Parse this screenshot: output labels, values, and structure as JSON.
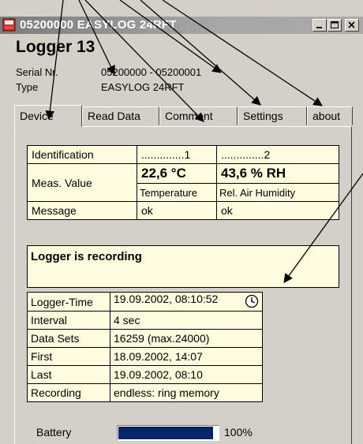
{
  "window": {
    "title": "05200000 EASYLOG 24RFT",
    "icon": "logger-app-icon",
    "controls": [
      "minimize",
      "maximize",
      "close"
    ]
  },
  "header": {
    "title": "Logger 13",
    "serial_label": "Serial Nr.",
    "serial_value": "05200000 - 05200001",
    "type_label": "Type",
    "type_value": "EASYLOG 24RFT"
  },
  "tabs": [
    {
      "label": "Device",
      "active": true
    },
    {
      "label": "Read Data"
    },
    {
      "label": "Comment"
    },
    {
      "label": "Settings"
    },
    {
      "label": "about"
    }
  ],
  "measurements": {
    "identification_label": "Identification",
    "id_1": "..............1",
    "id_2": "..............2",
    "meas_label": "Meas. Value",
    "value_1": "22,6 °C",
    "value_2": "43,6 % RH",
    "unit_1": "Temperature",
    "unit_2": "Rel. Air Humidity",
    "message_label": "Message",
    "message_1": "ok",
    "message_2": "ok"
  },
  "status": "Logger is recording",
  "info": {
    "time_label": "Logger-Time",
    "time_value": "19.09.2002, 08:10:52",
    "interval_label": "Interval",
    "interval_value": "4 sec",
    "datasets_label": "Data Sets",
    "datasets_value": "16259 (max.24000)",
    "first_label": "First",
    "first_value": "18.09.2002, 14:07",
    "last_label": "Last",
    "last_value": "19.09.2002, 08:10",
    "recording_label": "Recording",
    "recording_value": "endless: ring memory"
  },
  "battery": {
    "label": "Battery",
    "level": 0.95,
    "value_text": "100%",
    "fill_color": "#0a246a"
  },
  "colors": {
    "window_bg": "#d4d0c8",
    "table_bg": "#fffbdf",
    "titlebar_gradient_start": "#7b7b7b",
    "titlebar_text": "#ffffff"
  }
}
